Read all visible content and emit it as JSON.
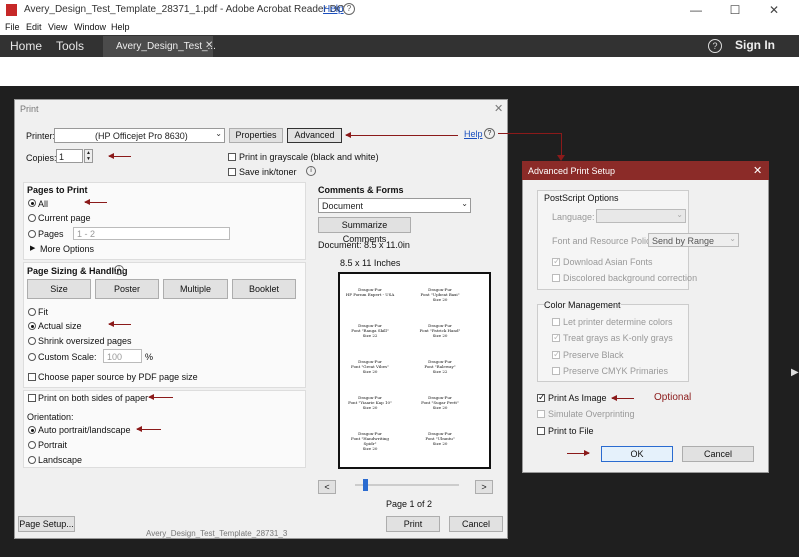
{
  "window": {
    "title": "Avery_Design_Test_Template_28371_1.pdf - Adobe Acrobat Reader DC",
    "help_link": "Help",
    "min": "—",
    "max": "☐",
    "close": "✕",
    "menu": [
      "File",
      "Edit",
      "View",
      "Window",
      "Help"
    ]
  },
  "appbar": {
    "home": "Home",
    "tools": "Tools",
    "doc_tab": "Avery_Design_Test_...",
    "doc_tab_close": "✕",
    "help_icon": "?",
    "sign_in": "Sign In"
  },
  "print": {
    "title": "Print",
    "close": "✕",
    "printer_label": "Printer:",
    "printer_value": "(HP Officejet Pro 8630)",
    "properties": "Properties",
    "advanced": "Advanced",
    "help": "Help",
    "copies_label": "Copies:",
    "copies_value": "1",
    "grayscale": "Print in grayscale (black and white)",
    "save_ink": "Save ink/toner",
    "pages_to_print": {
      "title": "Pages to Print",
      "all": "All",
      "current": "Current page",
      "pages": "Pages",
      "pages_value": "1 - 2",
      "more": "More Options"
    },
    "sizing": {
      "title": "Page Sizing & Handling",
      "tabs": [
        "Size",
        "Poster",
        "Multiple",
        "Booklet"
      ],
      "fit": "Fit",
      "actual": "Actual size",
      "shrink": "Shrink oversized pages",
      "custom": "Custom Scale:",
      "custom_value": "100",
      "percent": "%",
      "paper_source": "Choose paper source by PDF page size"
    },
    "both_sides": "Print on both sides of paper",
    "orientation": {
      "title": "Orientation:",
      "auto": "Auto portrait/landscape",
      "portrait": "Portrait",
      "landscape": "Landscape"
    },
    "comments": {
      "title": "Comments & Forms",
      "value": "Document",
      "summarize": "Summarize Comments"
    },
    "document_size": "Document: 8.5 x 11.0in",
    "preview_size": "8.5 x 11 Inches",
    "labels": [
      [
        "Dragon-Fur",
        "HP Pornm Expert - USA",
        "Dragon-Fur",
        "Font \"Upbeat Baxi\"",
        "Size 20"
      ],
      [
        "Dragon-Fur",
        "Font \"Ranga Skill\"",
        "Size 22",
        "Dragon-Fur",
        "Font \"Patrick Hand\"",
        "Size 20"
      ],
      [
        "Dragon-Fur",
        "Font \"Great Vibes\"",
        "Size 20",
        "Dragon-Fur",
        "Font \"Raleway\"",
        "Size 22"
      ],
      [
        "Dragon-Fur",
        "Font \"Yiaarie Kap 10\"",
        "Size 20",
        "Dragon-Fur",
        "Font \"Sugar Prett\"",
        "Size 20"
      ],
      [
        "Dragon-Fur",
        "Font \"Handwriting Spidr\"",
        "Size 20",
        "Dragon-Fur",
        "Font \"Ubuntu\"",
        "Size 20"
      ]
    ],
    "prev": "<",
    "next": ">",
    "page_count": "Page 1 of 2",
    "page_progress": 0.1,
    "page_setup": "Page Setup...",
    "footer_file": "Avery_Design_Test_Template_28731_3",
    "print_btn": "Print",
    "cancel_btn": "Cancel"
  },
  "advanced": {
    "title": "Advanced Print Setup",
    "close": "✕",
    "postscript": "PostScript Options",
    "language": "Language:",
    "font_policy": "Font and Resource Policy:",
    "font_policy_value": "Send by Range",
    "download_asian": "Download Asian Fonts",
    "discolored": "Discolored background correction",
    "color_mgmt": "Color Management",
    "let_printer": "Let printer determine colors",
    "treat_grays": "Treat grays as K-only grays",
    "preserve_black": "Preserve Black",
    "preserve_cmyk": "Preserve CMYK Primaries",
    "print_as_image": "Print As Image",
    "optional": "Optional",
    "simulate": "Simulate Overprinting",
    "print_to_file": "Print to File",
    "ok": "OK",
    "cancel": "Cancel"
  },
  "colors": {
    "accent": "#8b1a1a",
    "titlebar": "#8b2b28",
    "appbar": "#323232"
  }
}
